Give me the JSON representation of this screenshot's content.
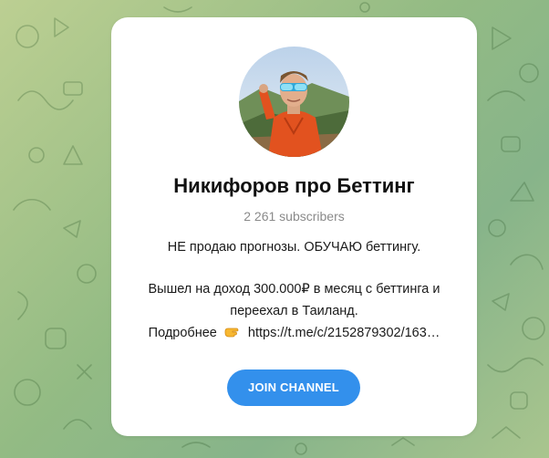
{
  "channel": {
    "title": "Никифоров про Беттинг",
    "subscribers": "2 261 subscribers",
    "description_line1": "НЕ продаю прогнозы. ОБУЧАЮ беттингу.",
    "description_line2": "Вышел на доход 300.000₽ в месяц с беттинга и",
    "description_line3": "переехал в Таиланд.",
    "description_more_label": "Подробнее",
    "description_link": "https://t.me/c/2152879302/163…",
    "hand_icon": "pointing-hand-emoji",
    "avatar_icon": "channel-avatar-photo"
  },
  "join_button": {
    "label": "JOIN CHANNEL"
  },
  "colors": {
    "accent": "#3390ec",
    "background": "#9cbf87",
    "card": "#ffffff",
    "subtext": "#8a8a8a"
  }
}
